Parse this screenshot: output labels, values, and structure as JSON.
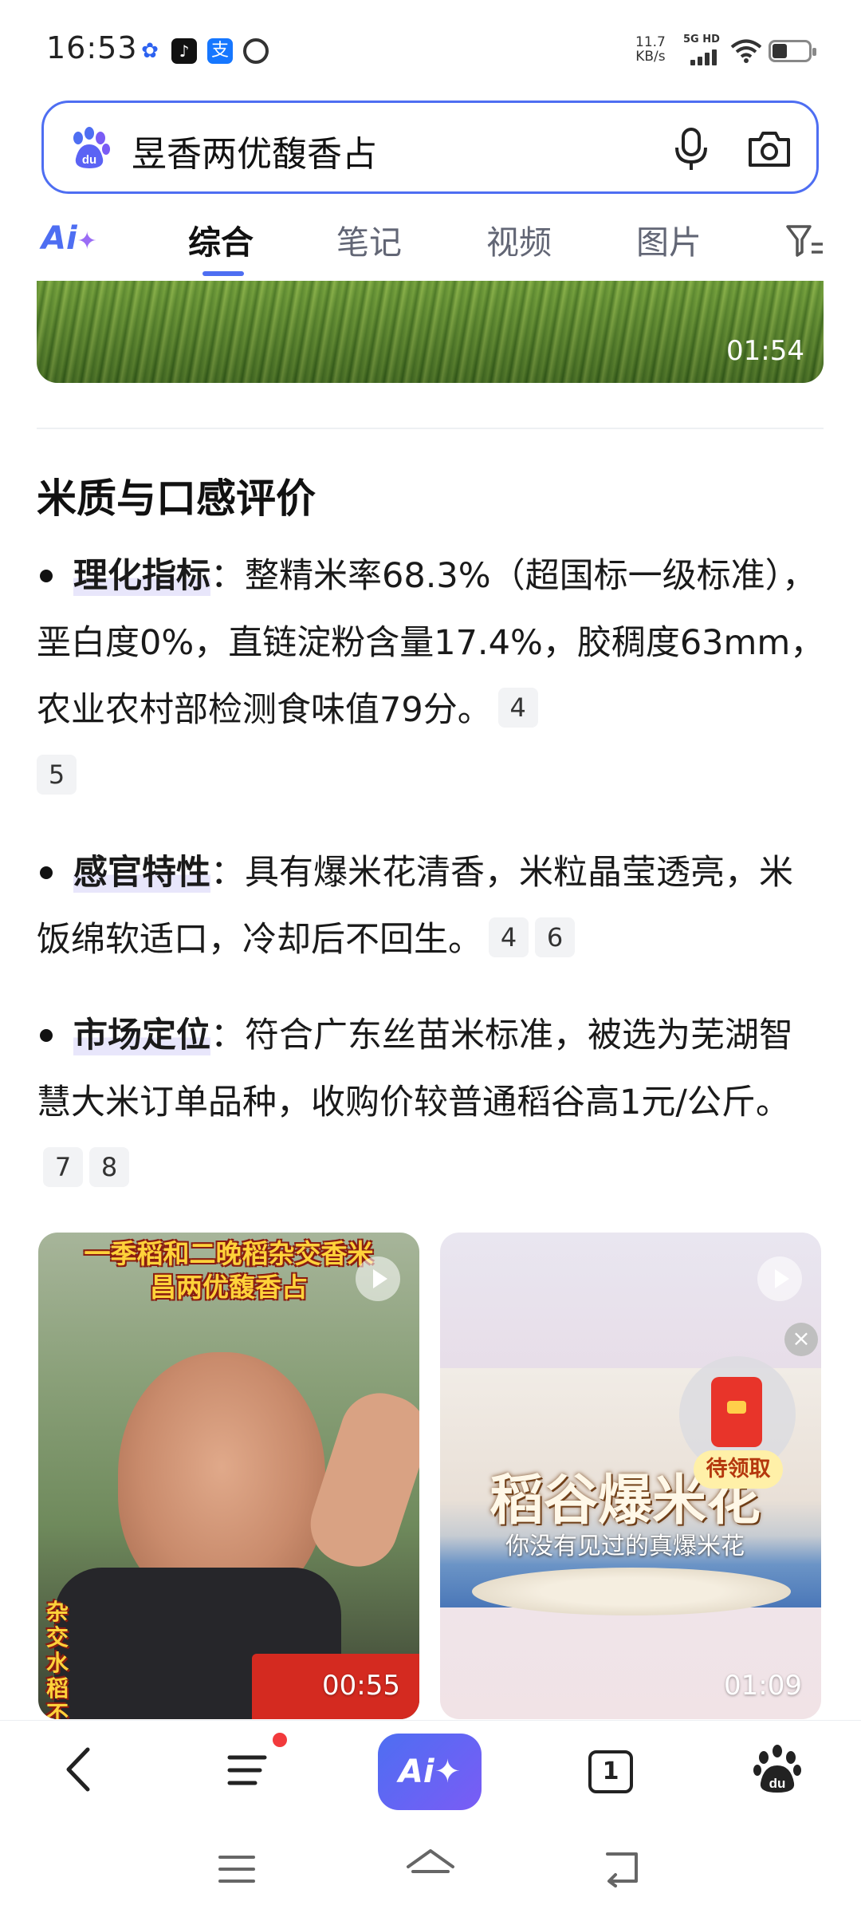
{
  "status_bar": {
    "time": "16:53",
    "net_speed_value": "11.7",
    "net_speed_unit": "KB/s",
    "network": "5G HD",
    "icons": [
      "baidu-icon",
      "tiktok-icon",
      "alipay-icon",
      "app-icon",
      "signal-icon",
      "wifi-icon",
      "battery-icon"
    ]
  },
  "search": {
    "query": "昱香两优馥香占",
    "icons": [
      "baidu-paw-icon",
      "microphone-icon",
      "camera-icon"
    ]
  },
  "tabs": {
    "ai_label": "Ai",
    "items": [
      {
        "label": "综合",
        "active": true
      },
      {
        "label": "笔记",
        "active": false
      },
      {
        "label": "视频",
        "active": false
      },
      {
        "label": "图片",
        "active": false
      }
    ],
    "filter_icon": "filter-icon"
  },
  "top_video": {
    "duration": "01:54"
  },
  "article": {
    "section_title": "米质与口感评价",
    "bullets": [
      {
        "keyword": "理化指标",
        "text": "：整精米率68.3%（超国标一级标准），垩白度0%，直链淀粉含量17.4%，胶稠度63mm，农业农村部检测食味值79分。",
        "refs": [
          "4",
          "5"
        ]
      },
      {
        "keyword": "感官特性",
        "text": "：具有爆米花清香，米粒晶莹透亮，米饭绵软适口，冷却后不回生。",
        "refs": [
          "4",
          "6"
        ]
      },
      {
        "keyword": "市场定位",
        "text": "：符合广东丝苗米标准，被选为芜湖智慧大米订单品种，收购价较普通稻谷高1元/公斤。",
        "refs": [
          "7",
          "8"
        ]
      }
    ]
  },
  "video_cards": [
    {
      "caption_line1": "一季稻和二晚稻杂交香米",
      "caption_line2": "昌两优馥香占",
      "side_text": "杂交水稻不可",
      "duration": "00:55"
    },
    {
      "title": "稻谷爆米花",
      "subtitle": "你没有见过的真爆米花",
      "duration": "01:09"
    }
  ],
  "red_packet": {
    "label": "待领取",
    "close_symbol": "×"
  },
  "bottom_bar": {
    "ai_label": "Ai",
    "tab_count": "1"
  },
  "colors": {
    "accent": "#4e6ef2",
    "ai_gradient_end": "#7a5cf5",
    "notification": "#f23a3c"
  }
}
